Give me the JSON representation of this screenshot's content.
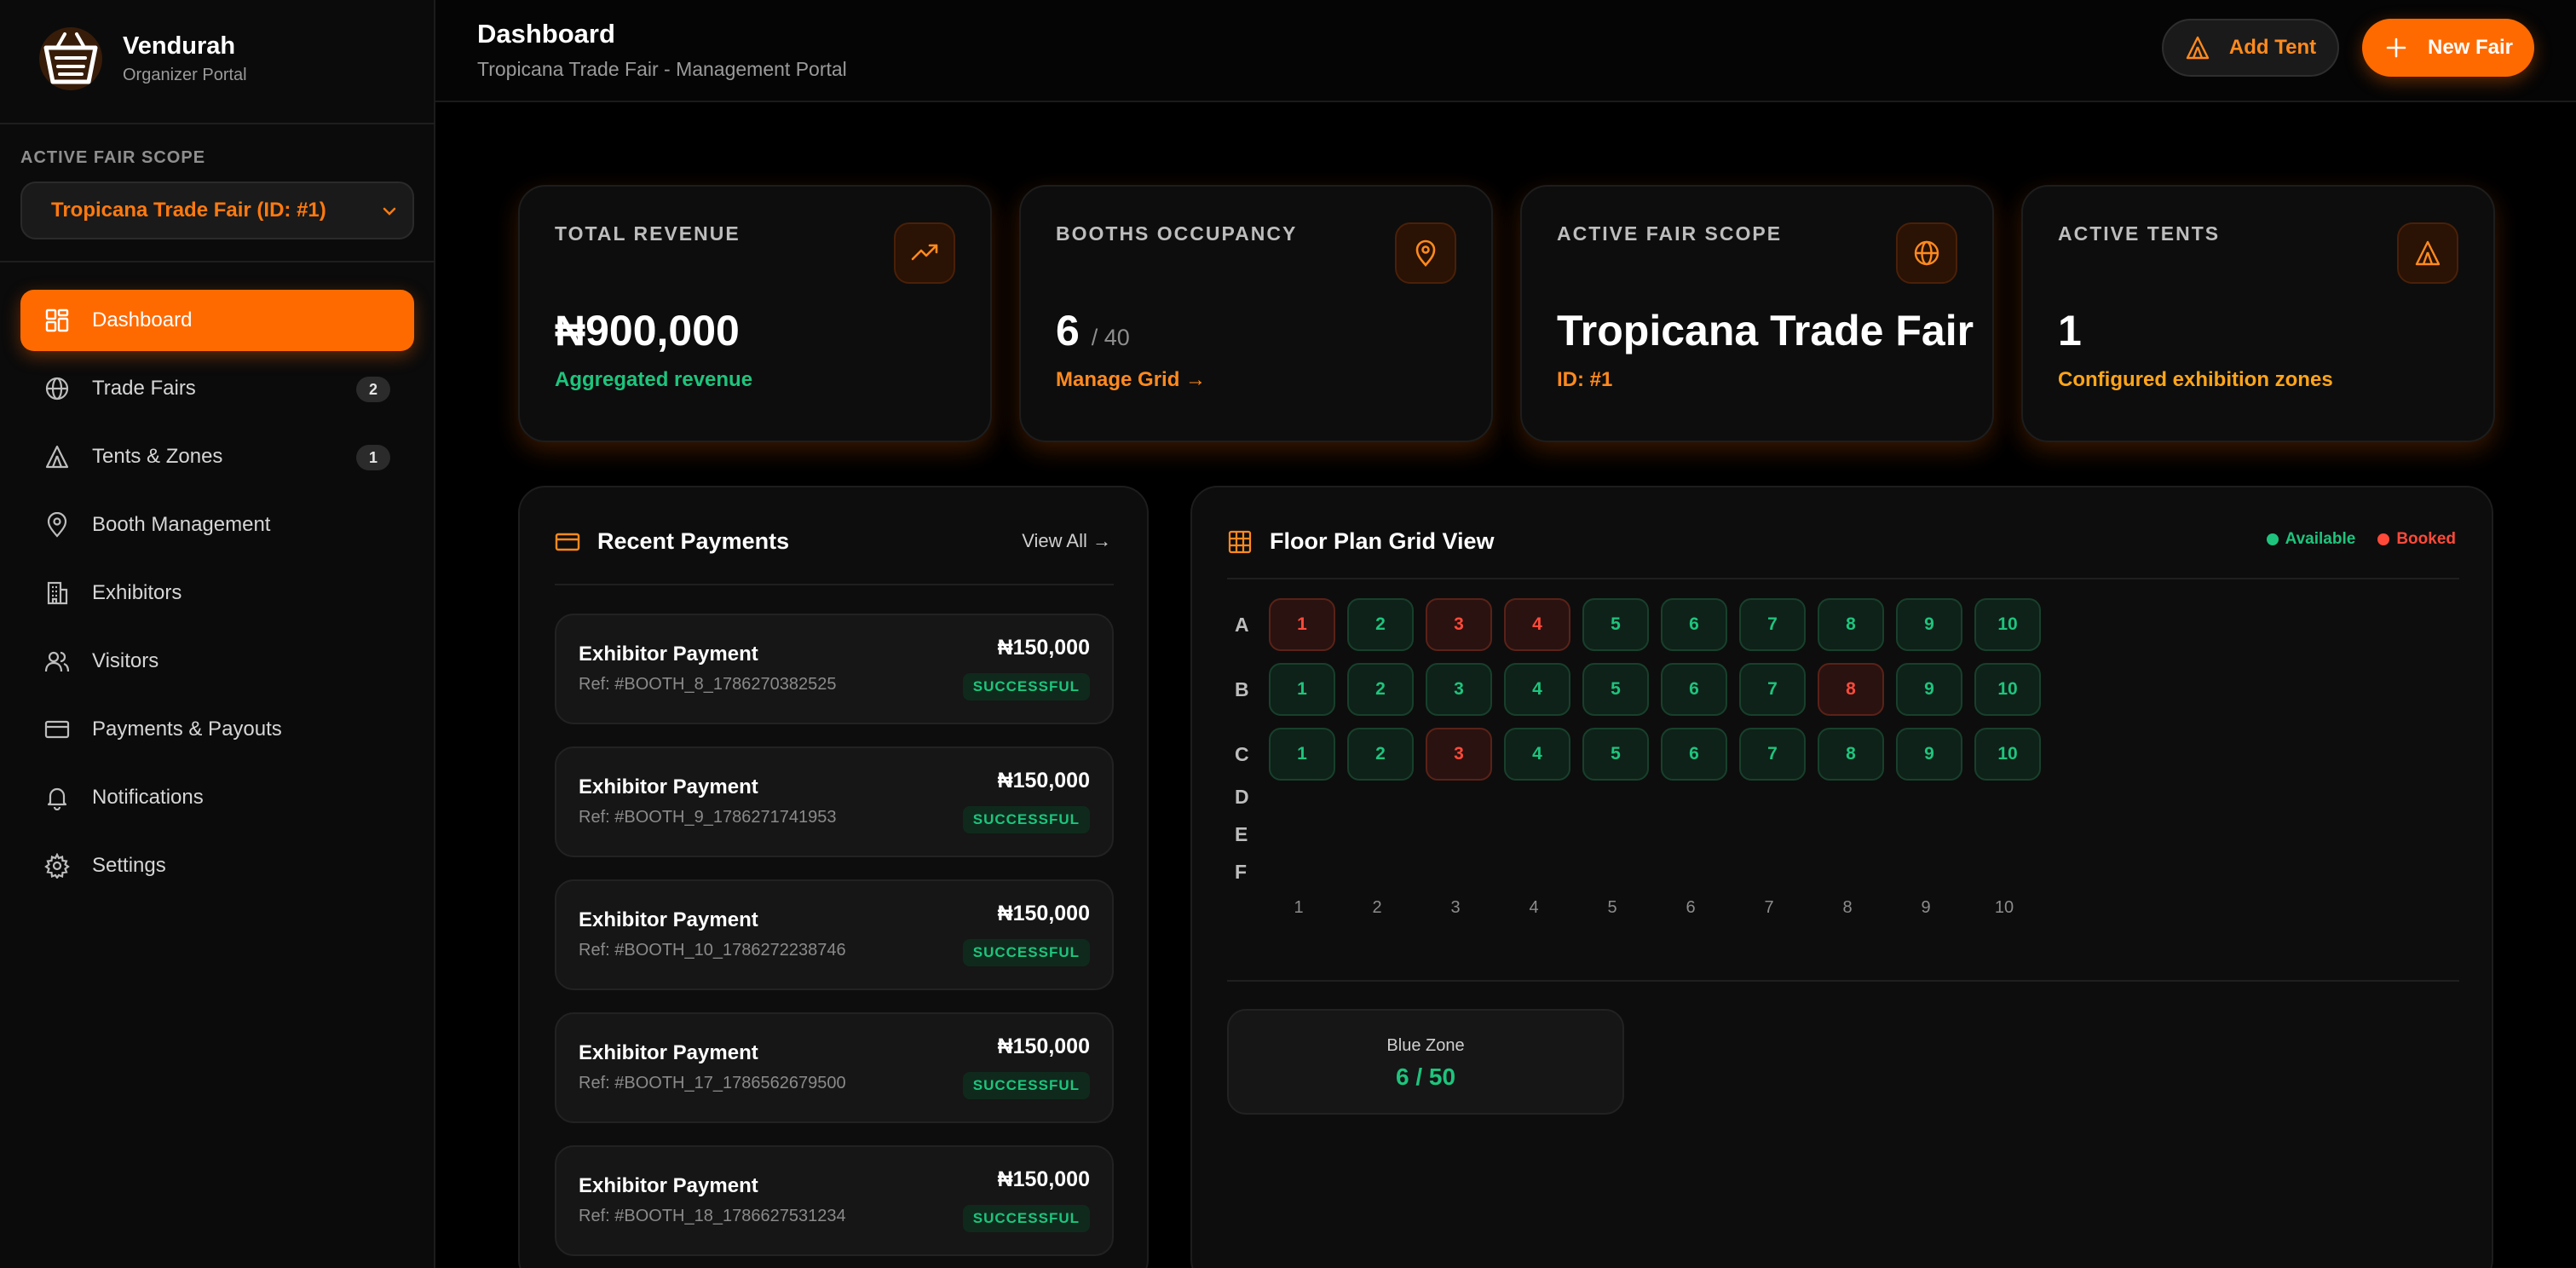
{
  "brand": {
    "name": "Vendurah",
    "subtitle": "Organizer Portal"
  },
  "scope": {
    "label": "ACTIVE FAIR SCOPE",
    "selected": "Tropicana Trade Fair (ID: #1)"
  },
  "nav": [
    {
      "label": "Dashboard",
      "icon": "dashboard-icon",
      "active": true
    },
    {
      "label": "Trade Fairs",
      "icon": "globe-icon",
      "badge": "2"
    },
    {
      "label": "Tents & Zones",
      "icon": "tent-icon",
      "badge": "1"
    },
    {
      "label": "Booth Management",
      "icon": "map-pin-icon"
    },
    {
      "label": "Exhibitors",
      "icon": "building-icon"
    },
    {
      "label": "Visitors",
      "icon": "users-icon"
    },
    {
      "label": "Payments & Payouts",
      "icon": "credit-card-icon"
    },
    {
      "label": "Notifications",
      "icon": "bell-icon"
    },
    {
      "label": "Settings",
      "icon": "gear-icon"
    }
  ],
  "header": {
    "title": "Dashboard",
    "subtitle": "Tropicana Trade Fair - Management Portal",
    "add_tent_label": "Add Tent",
    "new_fair_label": "New Fair"
  },
  "stats": {
    "revenue": {
      "label": "TOTAL REVENUE",
      "value": "₦900,000",
      "note": "Aggregated revenue"
    },
    "occupancy": {
      "label": "BOOTHS OCCUPANCY",
      "value": "6",
      "total": "/ 40",
      "note": "Manage Grid"
    },
    "scope": {
      "label": "ACTIVE FAIR SCOPE",
      "value": "Tropicana Trade Fair",
      "note": "ID: #1"
    },
    "tents": {
      "label": "ACTIVE TENTS",
      "value": "1",
      "note": "Configured exhibition zones"
    }
  },
  "payments": {
    "title": "Recent Payments",
    "view_all": "View All →",
    "items": [
      {
        "title": "Exhibitor Payment",
        "ref": "Ref: #BOOTH_8_1786270382525",
        "amount": "₦150,000",
        "status": "SUCCESSFUL"
      },
      {
        "title": "Exhibitor Payment",
        "ref": "Ref: #BOOTH_9_1786271741953",
        "amount": "₦150,000",
        "status": "SUCCESSFUL"
      },
      {
        "title": "Exhibitor Payment",
        "ref": "Ref: #BOOTH_10_1786272238746",
        "amount": "₦150,000",
        "status": "SUCCESSFUL"
      },
      {
        "title": "Exhibitor Payment",
        "ref": "Ref: #BOOTH_17_1786562679500",
        "amount": "₦150,000",
        "status": "SUCCESSFUL"
      },
      {
        "title": "Exhibitor Payment",
        "ref": "Ref: #BOOTH_18_1786627531234",
        "amount": "₦150,000",
        "status": "SUCCESSFUL"
      }
    ]
  },
  "floorplan": {
    "title": "Floor Plan Grid View",
    "legend_available": "Available",
    "legend_booked": "Booked",
    "rows": [
      "A",
      "B",
      "C",
      "D",
      "E",
      "F"
    ],
    "columns": [
      "1",
      "2",
      "3",
      "4",
      "5",
      "6",
      "7",
      "8",
      "9",
      "10"
    ],
    "booths": {
      "A": [
        "booked",
        "available",
        "booked",
        "booked",
        "available",
        "available",
        "available",
        "available",
        "available",
        "available"
      ],
      "B": [
        "available",
        "available",
        "available",
        "available",
        "available",
        "available",
        "available",
        "booked",
        "available",
        "available"
      ],
      "C": [
        "available",
        "available",
        "booked",
        "available",
        "available",
        "available",
        "available",
        "available",
        "available",
        "available"
      ]
    },
    "zone": {
      "name": "Blue Zone",
      "count": "6 / 50"
    }
  },
  "colors": {
    "accent": "#ff6a00",
    "available": "#1ec47d",
    "booked": "#ff4a3a"
  }
}
